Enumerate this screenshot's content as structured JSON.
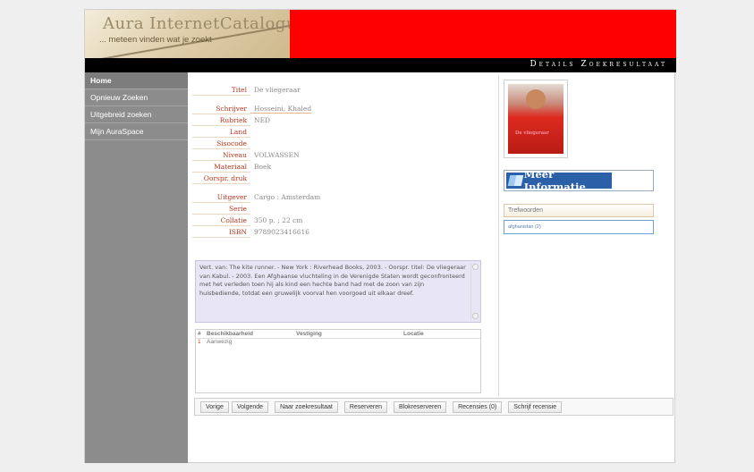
{
  "header": {
    "logo_title": "Aura InternetCatalogus",
    "logo_subtitle": "... meteen vinden wat je zoekt",
    "page_heading": "Details Zoekresultaat"
  },
  "sidebar": {
    "items": [
      {
        "label": "Home"
      },
      {
        "label": "Opnieuw Zoeken"
      },
      {
        "label": "Uitgebreid zoeken"
      },
      {
        "label": "Mijn AuraSpace"
      }
    ]
  },
  "record": {
    "titel": {
      "label": "Titel",
      "value": "De vliegeraar"
    },
    "schrijver": {
      "label": "Schrijver",
      "value": "Hosseini, Khaled"
    },
    "rubriek": {
      "label": "Rubriek",
      "value": "NED"
    },
    "land": {
      "label": "Land",
      "value": ""
    },
    "sisocode": {
      "label": "Sisocode",
      "value": ""
    },
    "niveau": {
      "label": "Niveau",
      "value": "VOLWASSEN"
    },
    "materiaal": {
      "label": "Materiaal",
      "value": "Boek"
    },
    "oorspr_druk": {
      "label": "Oorspr. druk",
      "value": ""
    },
    "uitgever": {
      "label": "Uitgever",
      "value": "Cargo : Amsterdam"
    },
    "serie": {
      "label": "Serie",
      "value": ""
    },
    "collatie": {
      "label": "Collatie",
      "value": "350 p. ; 22 cm"
    },
    "isbn": {
      "label": "ISBN",
      "value": "9789023416616"
    }
  },
  "summary": "Vert. van: The kite runner. - New York : Riverhead Books, 2003. - Oorspr. titel: De vliegeraar van Kabul. - 2003. Een Afghaanse vluchteling in de Verenigde Staten wordt geconfronteerd met het verleden toen hij als kind een hechte band had met de zoon van zijn huisbediende, totdat een gruwelijk voorval hen voorgoed uit elkaar dreef.",
  "availability": {
    "headers": [
      "#",
      "Beschikbaarheid",
      "Vestiging",
      "Locatie"
    ],
    "rows": [
      {
        "num": "1",
        "status": "Aanwezig",
        "vestiging": "",
        "locatie": ""
      }
    ]
  },
  "cover": {
    "caption": "De vliegeraar"
  },
  "meer_informatie": "Meer Informatie",
  "trefwoorden": {
    "heading": "Trefwoorden",
    "items": [
      "afghanistan (2)"
    ]
  },
  "buttons": {
    "vorige": "Vorige",
    "volgende": "Volgende",
    "naar_resultaat": "Naar zoekresultaat",
    "reserveren": "Reserveren",
    "blokreserveren": "Blokreserveren",
    "recensies": "Recensies (0)",
    "schrijf_recensie": "Schrijf recensie"
  },
  "colors": {
    "header_red": "#ff0000",
    "sidebar_gray": "#8c8c8c",
    "label_red": "#b5351f",
    "summary_bg": "#e8e6f4"
  }
}
